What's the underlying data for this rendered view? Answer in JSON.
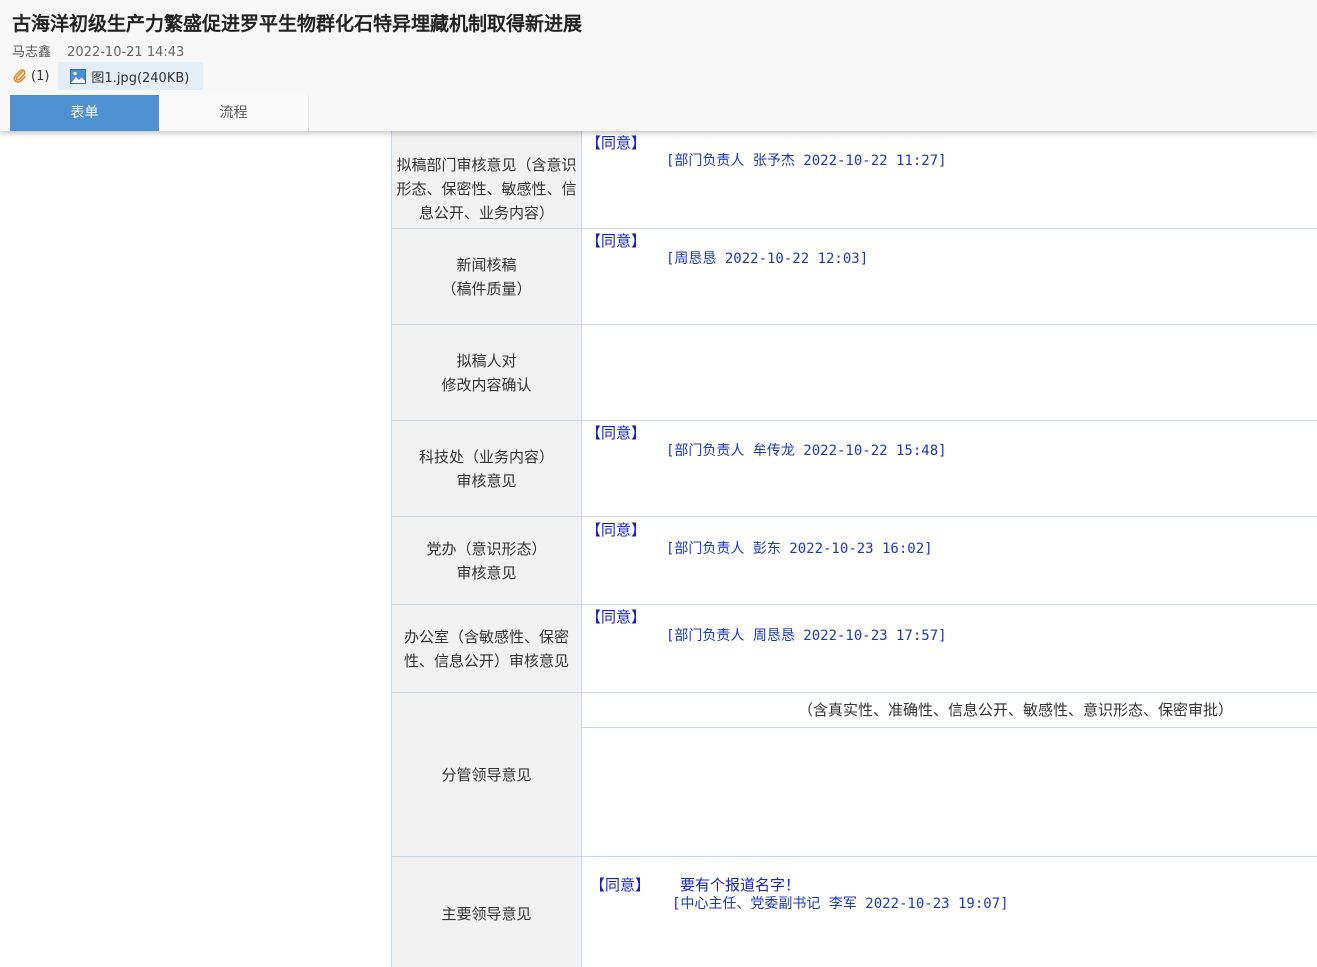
{
  "header": {
    "title": "古海洋初级生产力繁盛促进罗平生物群化石特异埋藏机制取得新进展",
    "author": "马志鑫",
    "datetime": "2022-10-21 14:43",
    "attachment_count": "(1)",
    "attachment_label": "图1.jpg(240KB)"
  },
  "tabs": [
    {
      "label": "表单"
    },
    {
      "label": "流程"
    }
  ],
  "form": {
    "draft_dept": {
      "label": "拟稿部门审核意见（含意识形态、保密性、敏感性、信息公开、业务内容）",
      "agree": "【同意】",
      "signature": "[部门负责人 张予杰 2022-10-22 11:27]"
    },
    "news_check": {
      "label_line1": "新闻核稿",
      "label_line2": "（稿件质量）",
      "agree": "【同意】",
      "signature": "[周恳恳 2022-10-22 12:03]"
    },
    "drafter_confirm": {
      "label_line1": "拟稿人对",
      "label_line2": "修改内容确认"
    },
    "tech_dept": {
      "label_line1": "科技处（业务内容）",
      "label_line2": "审核意见",
      "agree": "【同意】",
      "signature": "[部门负责人 牟传龙 2022-10-22 15:48]"
    },
    "party_office": {
      "label_line1": "党办（意识形态）",
      "label_line2": "审核意见",
      "agree": "【同意】",
      "signature": "[部门负责人 彭东 2022-10-23 16:02]"
    },
    "general_office": {
      "label_line1": "办公室（含敏感性、保密",
      "label_line2": "性、信息公开）审核意见",
      "agree": "【同意】",
      "signature": "[部门负责人 周恳恳 2022-10-23 17:57]"
    },
    "leader_in_charge": {
      "label": "分管领导意见",
      "note": "（含真实性、准确性、信息公开、敏感性、意识形态、保密审批）"
    },
    "main_leader": {
      "label": "主要领导意见",
      "agree": "【同意】",
      "comment": "要有个报道名字！",
      "signature": "[中心主任、党委副书记 李军 2022-10-23 19:07]"
    }
  },
  "colors": {
    "tab_active": "#4f90d0",
    "opinion_text": "#1522c8",
    "label_bg": "#f2f2f2",
    "border": "#c9d7e6"
  }
}
